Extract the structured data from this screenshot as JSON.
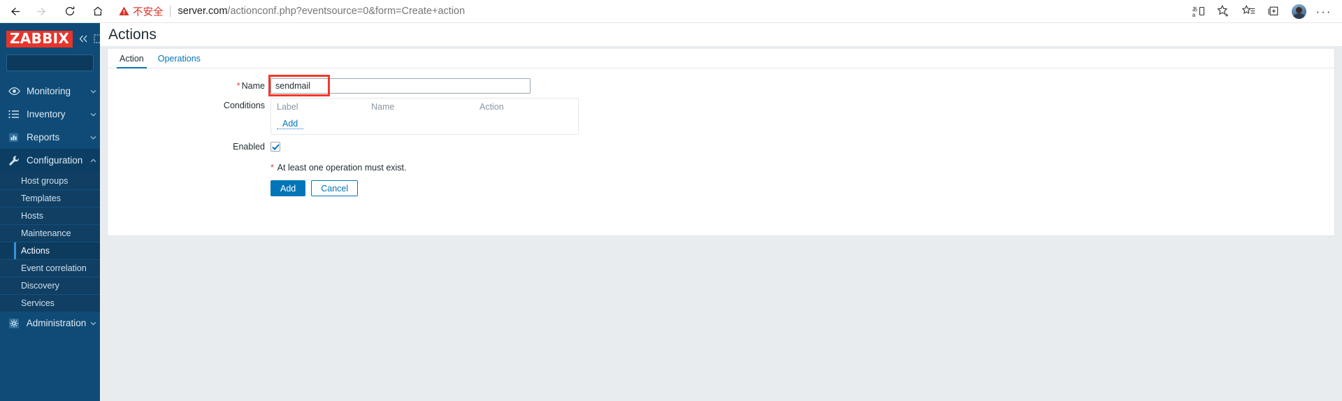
{
  "browser": {
    "back_label": "back-arrow",
    "forward_label": "forward-arrow",
    "reload_label": "reload",
    "home_label": "home",
    "security_warning": "不安全",
    "url_host": "server.com",
    "url_path": "/actionconf.php?eventsource=0&form=Create+action",
    "icons": {
      "translate": "translate-icon",
      "add_favorite": "add-favorite-icon",
      "favorites": "favorites-icon",
      "collections": "collections-icon",
      "profile": "profile-avatar",
      "settings_more": "more-options-icon"
    }
  },
  "sidebar": {
    "logo": "ZABBIX",
    "collapse_label": "collapse-sidebar",
    "hide_label": "hide-sidebar",
    "search": {
      "value": "",
      "placeholder": ""
    },
    "items": [
      {
        "label": "Monitoring",
        "icon": "eye-icon",
        "expanded": false
      },
      {
        "label": "Inventory",
        "icon": "list-icon",
        "expanded": false
      },
      {
        "label": "Reports",
        "icon": "bar-chart-icon",
        "expanded": false
      },
      {
        "label": "Configuration",
        "icon": "wrench-icon",
        "expanded": true
      },
      {
        "label": "Administration",
        "icon": "gear-icon",
        "expanded": false
      }
    ],
    "configuration_subitems": [
      {
        "label": "Host groups",
        "selected": false
      },
      {
        "label": "Templates",
        "selected": false
      },
      {
        "label": "Hosts",
        "selected": false
      },
      {
        "label": "Maintenance",
        "selected": false
      },
      {
        "label": "Actions",
        "selected": true
      },
      {
        "label": "Event correlation",
        "selected": false
      },
      {
        "label": "Discovery",
        "selected": false
      },
      {
        "label": "Services",
        "selected": false
      }
    ]
  },
  "page": {
    "title": "Actions",
    "tabs": [
      {
        "label": "Action",
        "active": true
      },
      {
        "label": "Operations",
        "active": false
      }
    ]
  },
  "form": {
    "name_label": "Name",
    "name_required": "*",
    "name_value": "sendmail",
    "name_placeholder": "",
    "conditions_label": "Conditions",
    "conditions_columns": [
      "Label",
      "Name",
      "Action"
    ],
    "conditions_add": "Add",
    "enabled_label": "Enabled",
    "enabled_checked": true,
    "footnote_asterisk": "*",
    "footnote_text": "At least one operation must exist.",
    "submit_label": "Add",
    "cancel_label": "Cancel"
  },
  "colors": {
    "zabbix_red": "#e8342a",
    "sidebar_blue": "#0f4b76",
    "accent_blue": "#0275b8",
    "highlight_red": "#f3382a",
    "warning_red": "#d93025"
  }
}
